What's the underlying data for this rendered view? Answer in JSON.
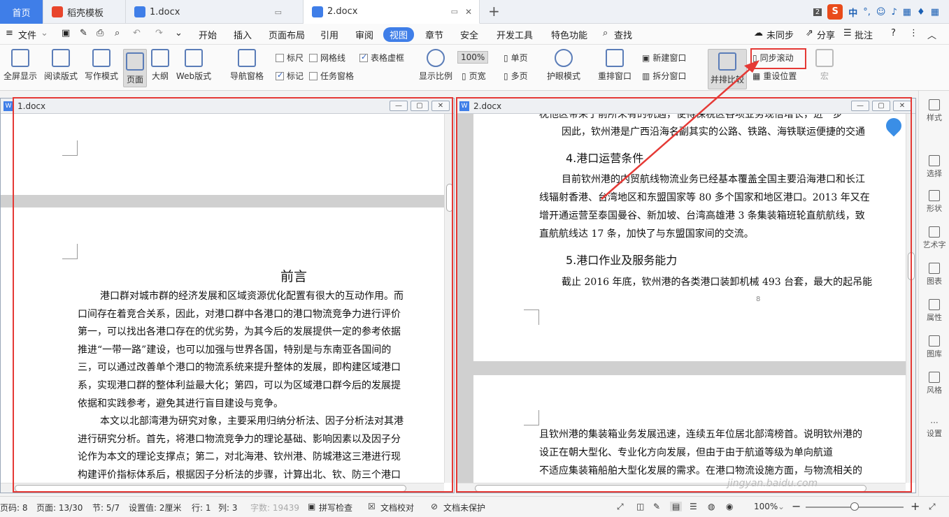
{
  "tabs": {
    "home": "首页",
    "template": "稻壳模板",
    "doc1": "1.docx",
    "doc2": "2.docx",
    "badge": "2"
  },
  "ime": {
    "brand": "S",
    "lang": "中"
  },
  "menu": {
    "file": "文件",
    "items": [
      "开始",
      "插入",
      "页面布局",
      "引用",
      "审阅",
      "视图",
      "章节",
      "安全",
      "开发工具",
      "特色功能"
    ],
    "search": "查找",
    "sync": "未同步",
    "share": "分享",
    "review": "批注"
  },
  "ribbon": {
    "fullscreen": "全屏显示",
    "read": "阅读版式",
    "write": "写作模式",
    "page": "页面",
    "outline": "大纲",
    "web": "Web版式",
    "nav": "导航窗格",
    "ruler": "标尺",
    "grid": "网格线",
    "tableline": "表格虚框",
    "mark": "标记",
    "task": "任务窗格",
    "zoom": "显示比例",
    "zoom_val": "100%",
    "pagewidth": "页宽",
    "single": "单页",
    "multi": "多页",
    "eye": "护眼模式",
    "rearrange": "重排窗口",
    "newwin": "新建窗口",
    "split": "拆分窗口",
    "sidebyside": "并排比较",
    "syncscroll": "同步滚动",
    "resetpos": "重设位置",
    "macro": "宏"
  },
  "left_window": {
    "title": "1.docx",
    "heading": "前言",
    "lines": [
      "港口群对城市群的经济发展和区域资源优化配置有很大的互动作用。而",
      "口间存在着竞合关系，因此，对港口群中各港口的港口物流竞争力进行评价",
      "第一，可以找出各港口存在的优劣势，为其今后的发展提供一定的参考依据",
      "推进“一带一路”建设，也可以加强与世界各国，特别是与东南亚各国间的",
      "三，可以通过改善单个港口的物流系统来提升整体的发展，即构建区域港口",
      "系，实现港口群的整体利益最大化；第四，可以为区域港口群今后的发展提",
      "依据和实践参考，避免其进行盲目建设与竞争。",
      "本文以北部湾港为研究对象，主要采用归纳分析法、因子分析法对其港",
      "进行研究分析。首先，将港口物流竞争力的理论基础、影响因素以及因子分",
      "论作为本文的理论支撑点；第二，对北海港、钦州港、防城港这三港进行现",
      "构建评价指标体系后，根据因子分析法的步骤，计算出北、钦、防三个港口"
    ]
  },
  "right_window": {
    "title": "2.docx",
    "top_lines": [
      "枕他区带来了前所未有的机遇，使得保税区各项业务现倍增长，进一步",
      "因此，钦州港是广西沿海名副其实的公路、铁路、海铁联运便捷的交通"
    ],
    "h4": "4.港口运营条件",
    "p4": [
      "目前钦州港的内贸航线物流业务已经基本覆盖全国主要沿海港口和长江",
      "线辐射香港、台湾地区和东盟国家等 80 多个国家和地区港口。2013 年又在",
      "增开通运营至泰国曼谷、新加坡、台湾高雄港 3 条集装箱班轮直航航线，致",
      "直航航线达 17 条，加快了与东盟国家间的交流。"
    ],
    "h5": "5.港口作业及服务能力",
    "p5": "截止 2016 年底，钦州港的各类港口装卸机械 493 台套，最大的起吊能",
    "pagenum": "8",
    "bottom_lines": [
      "且钦州港的集装箱业务发展迅速，连续五年位居北部湾榜首。说明钦州港的",
      "设正在朝大型化、专业化方向发展，但由于由于航道等级为单向航道",
      "不适应集装箱船舶大型化发展的需求。在港口物流设施方面，与物流相关的"
    ]
  },
  "right_panel": [
    "样式",
    "选择",
    "形状",
    "艺术字",
    "图表",
    "属性",
    "图库",
    "风格",
    "设置"
  ],
  "status": {
    "page": "页码: 8",
    "pages": "页面: 13/30",
    "section": "节: 5/7",
    "setting": "设置值: 2厘米",
    "row": "行: 1",
    "col": "列: 3",
    "words": "字数: 19439",
    "spell": "拼写检查",
    "proof": "文档校对",
    "protect": "文档未保护",
    "zoom": "100%"
  },
  "watermark": "jingyan.baidu.com"
}
